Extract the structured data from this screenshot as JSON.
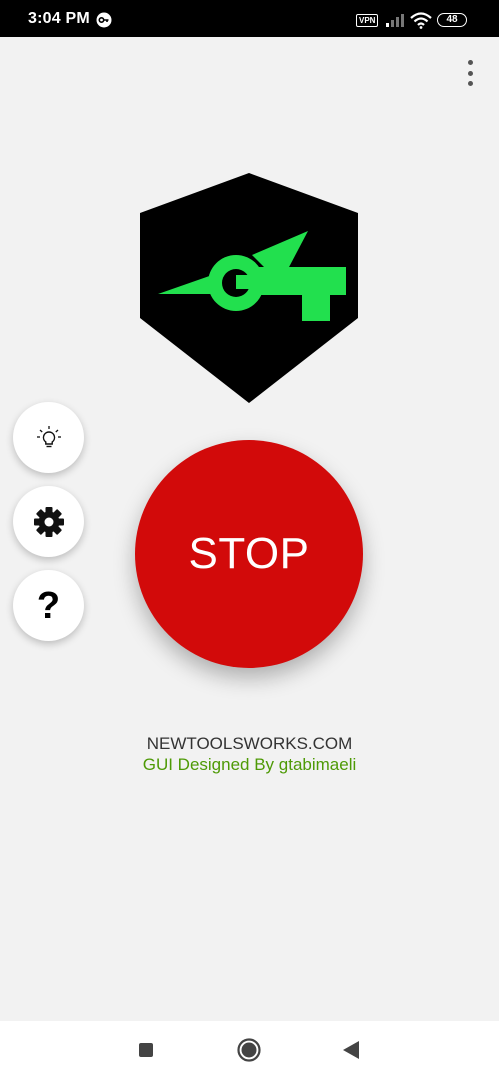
{
  "status_bar": {
    "time": "3:04 PM",
    "vpn_label": "VPN",
    "battery_level": "48",
    "icons": [
      "key-icon",
      "signal-icon",
      "wifi-icon",
      "battery-icon"
    ]
  },
  "menu": {
    "icon": "more-vert-icon"
  },
  "logo": {
    "icon": "app-logo",
    "colors": {
      "shield": "#000000",
      "mark": "#22e04e"
    }
  },
  "side_buttons": [
    {
      "icon": "lightbulb-icon"
    },
    {
      "icon": "gear-icon"
    },
    {
      "icon": "help-icon",
      "glyph": "?"
    }
  ],
  "main_button": {
    "label": "STOP",
    "color": "#d20a0a"
  },
  "footer": {
    "site": "NEWTOOLSWORKS.COM",
    "credit": "GUI  Designed By gtabimaeli",
    "credit_color": "#4e9a06"
  },
  "nav_bar": {
    "icons": [
      "recent-apps-icon",
      "home-icon",
      "back-icon"
    ]
  }
}
